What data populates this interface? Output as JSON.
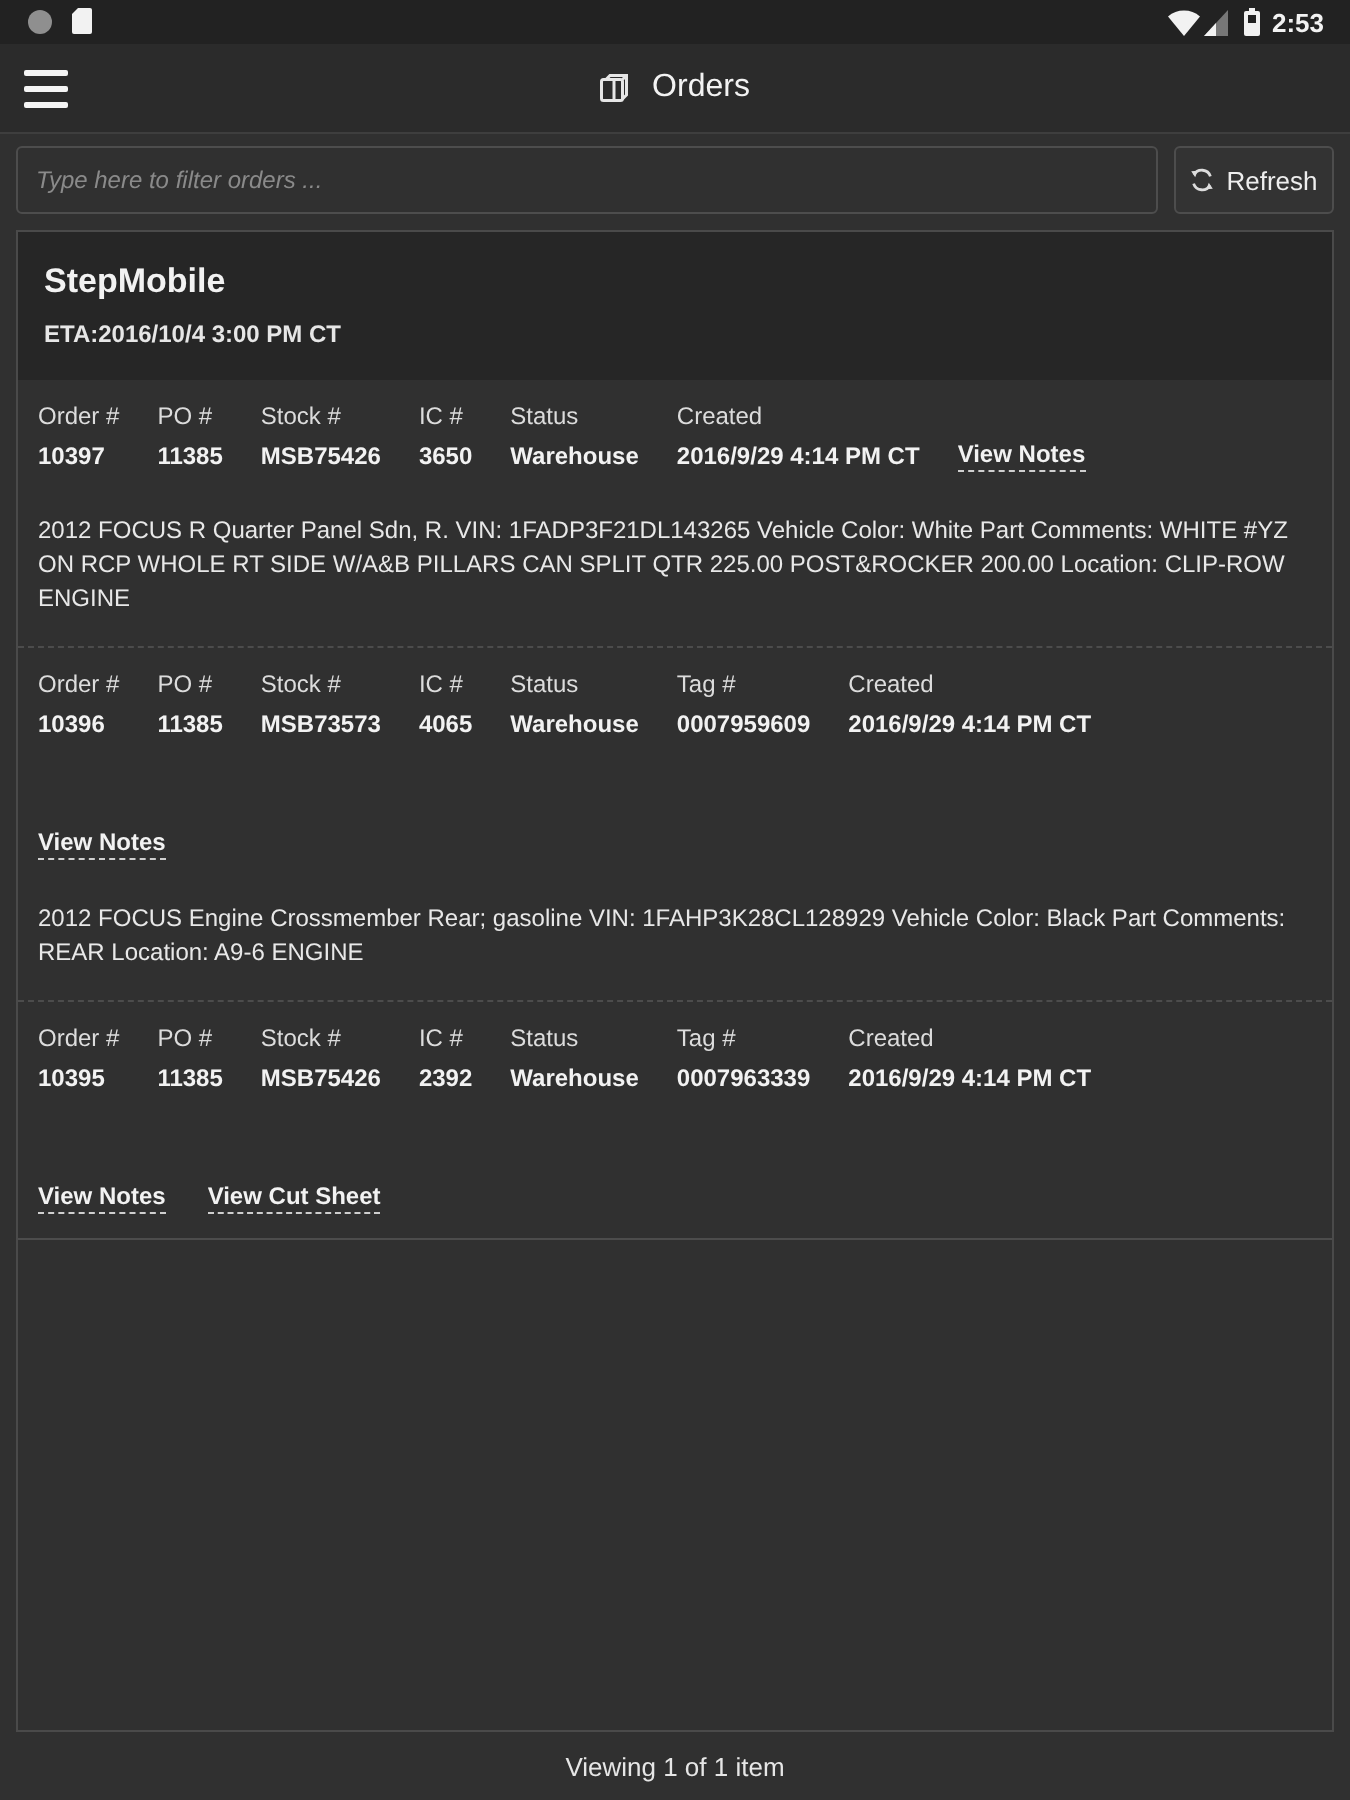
{
  "status_bar": {
    "time": "2:53"
  },
  "app_bar": {
    "title": "Orders"
  },
  "filter": {
    "placeholder": "Type here to filter orders ...",
    "refresh_label": "Refresh"
  },
  "customer": {
    "name": "StepMobile",
    "eta": "ETA:2016/10/4 3:00 PM CT"
  },
  "orders": [
    {
      "kind": "inline",
      "fields": [
        {
          "label": "Order #",
          "value": "10397"
        },
        {
          "label": "PO #",
          "value": "11385"
        },
        {
          "label": "Stock #",
          "value": "MSB75426"
        },
        {
          "label": "IC #",
          "value": "3650"
        },
        {
          "label": "Status",
          "value": "Warehouse"
        },
        {
          "label": "Created",
          "value": "2016/9/29 4:14 PM CT"
        }
      ],
      "links": [
        "View Notes"
      ],
      "description": "2012 FOCUS R Quarter Panel Sdn, R. VIN: 1FADP3F21DL143265 Vehicle Color: White Part Comments: WHITE #YZ ON RCP WHOLE RT SIDE W/A&B PILLARS CAN SPLIT QTR 225.00 POST&ROCKER 200.00 Location: CLIP-ROW ENGINE"
    },
    {
      "kind": "stacked",
      "fields": [
        {
          "label": "Order #",
          "value": "10396"
        },
        {
          "label": "PO #",
          "value": "11385"
        },
        {
          "label": "Stock #",
          "value": "MSB73573"
        },
        {
          "label": "IC #",
          "value": "4065"
        },
        {
          "label": "Status",
          "value": "Warehouse"
        },
        {
          "label": "Tag #",
          "value": "0007959609"
        },
        {
          "label": "Created",
          "value": "2016/9/29 4:14 PM CT"
        }
      ],
      "links": [
        "View Notes"
      ],
      "description": "2012 FOCUS Engine Crossmember Rear; gasoline VIN: 1FAHP3K28CL128929 Vehicle Color: Black Part Comments: REAR Location: A9-6 ENGINE"
    },
    {
      "kind": "stacked",
      "fields": [
        {
          "label": "Order #",
          "value": "10395"
        },
        {
          "label": "PO #",
          "value": "11385"
        },
        {
          "label": "Stock #",
          "value": "MSB75426"
        },
        {
          "label": "IC #",
          "value": "2392"
        },
        {
          "label": "Status",
          "value": "Warehouse"
        },
        {
          "label": "Tag #",
          "value": "0007963339"
        },
        {
          "label": "Created",
          "value": "2016/9/29 4:14 PM CT"
        }
      ],
      "links": [
        "View Notes",
        "View Cut Sheet"
      ]
    }
  ],
  "footer": {
    "text": "Viewing 1 of 1 item"
  }
}
